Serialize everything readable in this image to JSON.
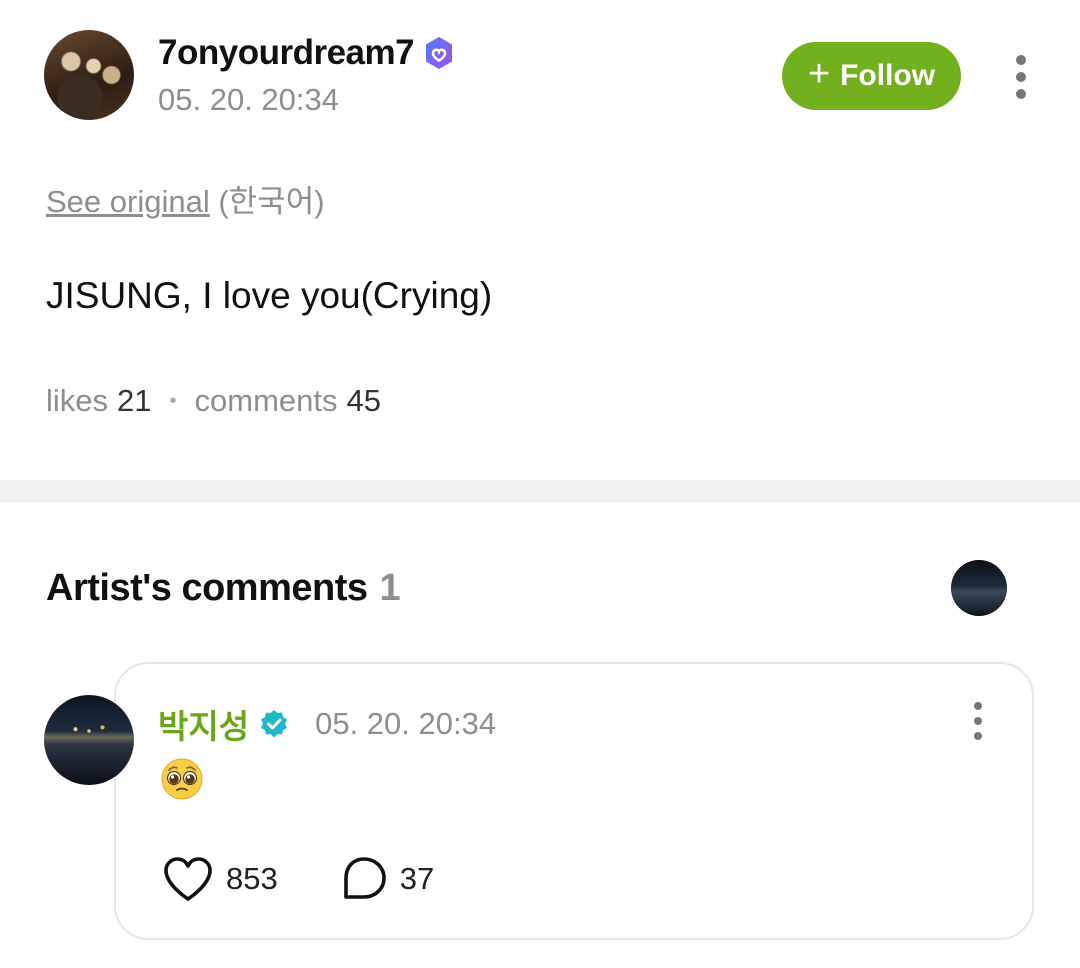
{
  "post": {
    "author": "7onyourdream7",
    "time": "05. 20. 20:34",
    "follow_label": "Follow",
    "see_original_link": "See original",
    "see_original_lang": "(한국어)",
    "text": "JISUNG, I love you(Crying)",
    "likes_label": "likes",
    "likes_count": "21",
    "comments_label": "comments",
    "comments_count": "45"
  },
  "artist_comments": {
    "title": "Artist's comments",
    "count": "1"
  },
  "comment": {
    "author": "박지성",
    "time": "05. 20. 20:34",
    "emoji": "pleading-face",
    "likes": "853",
    "replies": "37"
  },
  "colors": {
    "accent_green": "#72b01d",
    "name_green": "#6aa51a",
    "verified_purple": "#7b5cf0",
    "verified_teal": "#1fb8c8",
    "muted_text": "#8e8e8e"
  },
  "icons": [
    "verified-badge-icon",
    "plus-icon",
    "more-vertical-icon",
    "heart-icon",
    "comment-bubble-icon"
  ]
}
